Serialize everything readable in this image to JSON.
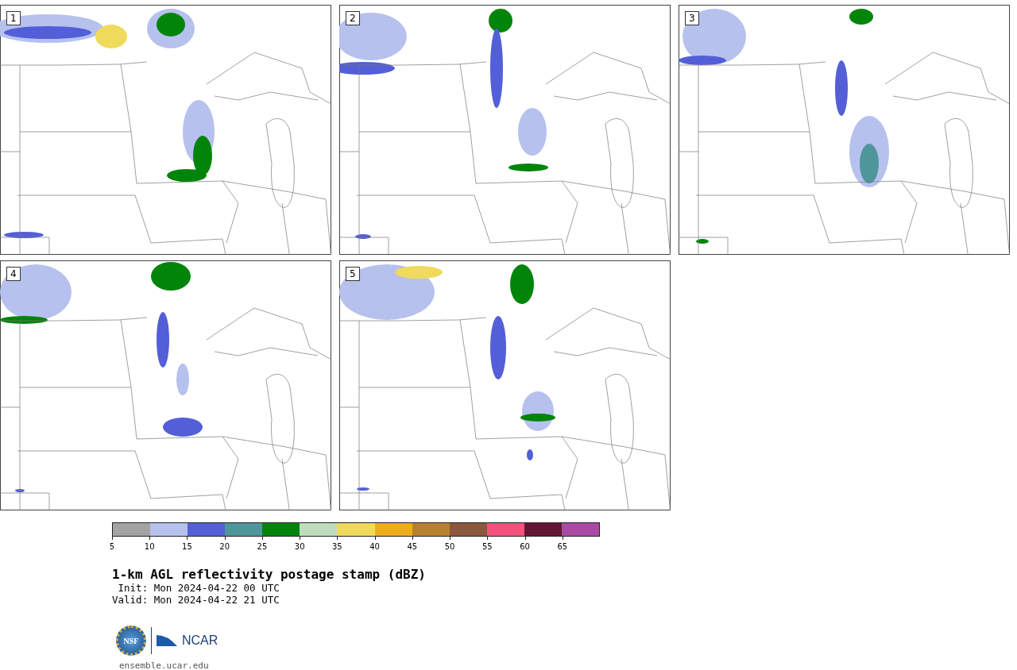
{
  "panels": [
    {
      "number": "1"
    },
    {
      "number": "2"
    },
    {
      "number": "3"
    },
    {
      "number": "4"
    },
    {
      "number": "5"
    }
  ],
  "colorbar": {
    "segments": [
      {
        "color": "#a3a3a3"
      },
      {
        "color": "#b7c1ee"
      },
      {
        "color": "#535fd8"
      },
      {
        "color": "#4f969b"
      },
      {
        "color": "#00840a"
      },
      {
        "color": "#bfdcbf"
      },
      {
        "color": "#f0da5b"
      },
      {
        "color": "#efae18"
      },
      {
        "color": "#b8812f"
      },
      {
        "color": "#8a583c"
      },
      {
        "color": "#f5517d"
      },
      {
        "color": "#631633"
      },
      {
        "color": "#aa4aa5"
      }
    ],
    "ticks": [
      "5",
      "10",
      "15",
      "20",
      "25",
      "30",
      "35",
      "40",
      "45",
      "50",
      "55",
      "60",
      "65"
    ]
  },
  "title": "1-km AGL reflectivity postage stamp (dBZ)",
  "init": " Init: Mon 2024-04-22 00 UTC",
  "valid": "Valid: Mon 2024-04-22 21 UTC",
  "logo": {
    "nsf": "NSF",
    "ncar": "NCAR"
  },
  "footer": "ensemble.ucar.edu"
}
